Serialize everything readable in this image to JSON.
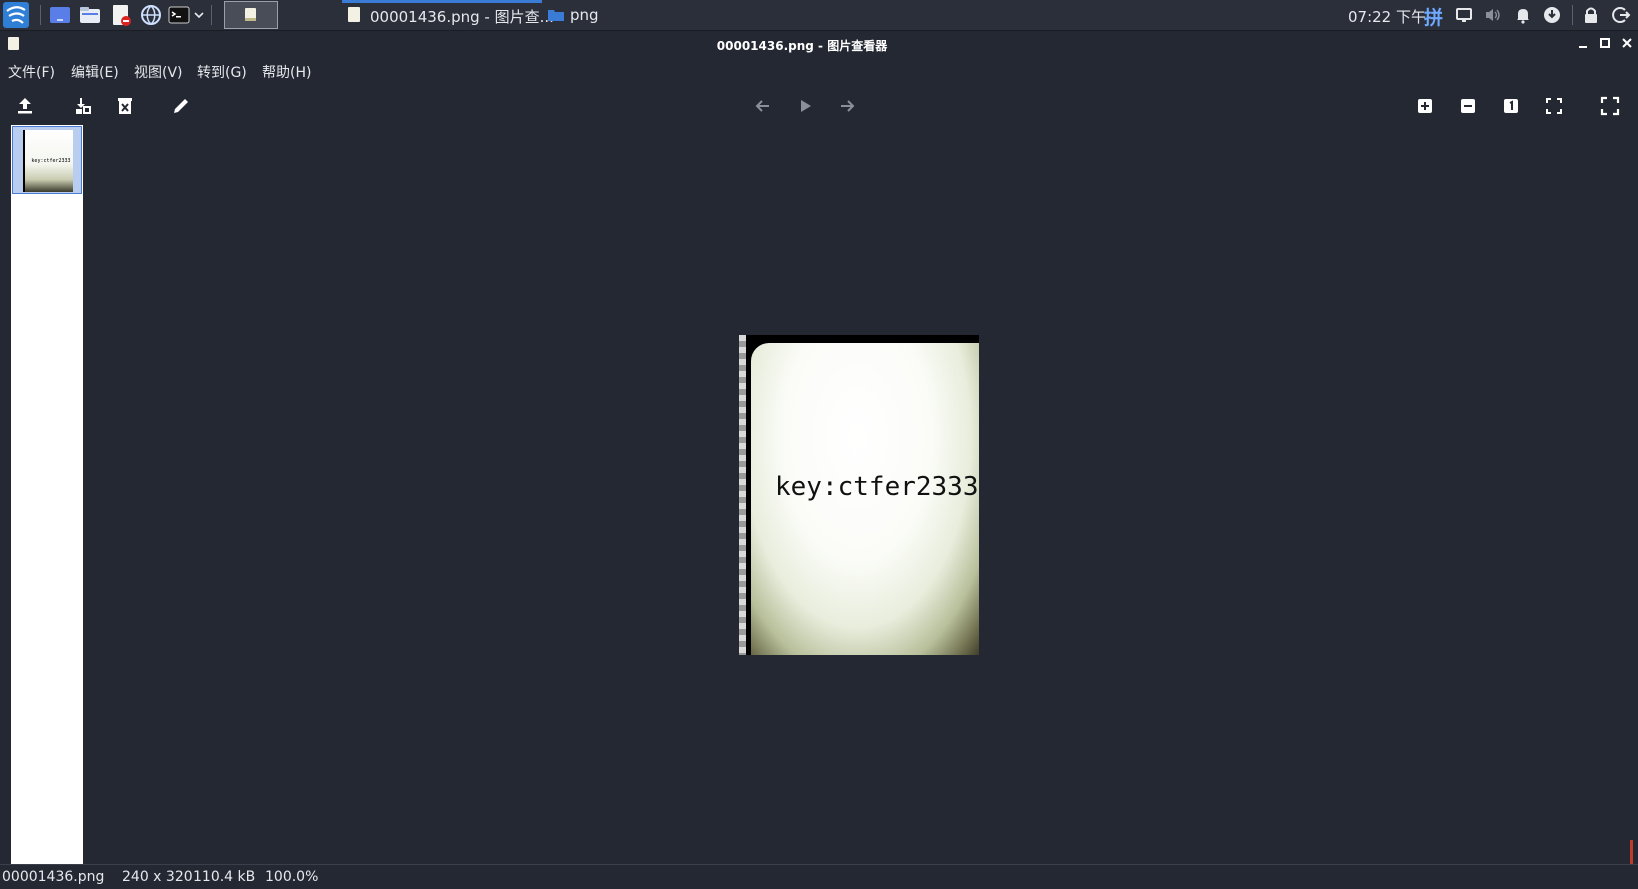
{
  "taskbar": {
    "window_tab_label": "00001436.png - 图片查...",
    "folder_label": "png",
    "clock": "07:22 下午",
    "ime_indicator": "拼"
  },
  "window": {
    "title": "00001436.png - 图片查看器"
  },
  "menu": {
    "file": "文件(F)",
    "edit": "编辑(E)",
    "view": "视图(V)",
    "goto": "转到(G)",
    "help": "帮助(H)"
  },
  "thumbnail": {
    "caption": "key:ctfer2333"
  },
  "image": {
    "text": "key:ctfer2333"
  },
  "status": {
    "filename": "00001436.png",
    "dimensions": "240 x 320",
    "filesize": "110.4 kB",
    "zoom": "100.0%"
  },
  "colors": {
    "background": "#242832",
    "accent": "#3a7bd5",
    "sidebar": "#ffffff"
  },
  "icons": {
    "taskbar": [
      "kali-menu-icon",
      "desktop-icon",
      "file-manager-icon",
      "text-editor-icon",
      "browser-icon",
      "terminal-icon",
      "dropdown-icon"
    ],
    "tray": [
      "ime-icon",
      "display-icon",
      "volume-icon",
      "notification-icon",
      "update-icon",
      "lock-icon",
      "logout-icon"
    ],
    "toolbar": [
      "open-icon",
      "save-icon",
      "delete-icon",
      "edit-icon",
      "prev-icon",
      "play-icon",
      "next-icon",
      "zoom-in-icon",
      "zoom-out-icon",
      "actual-size-icon",
      "fit-icon",
      "fullscreen-icon"
    ]
  }
}
